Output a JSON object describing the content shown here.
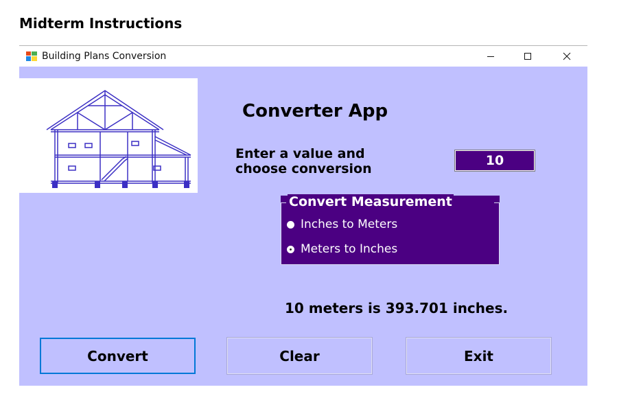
{
  "page": {
    "heading": "Midterm Instructions"
  },
  "window": {
    "title": "Building Plans Conversion",
    "icon": "app-form-icon",
    "controls": {
      "minimize_icon": "minimize-icon",
      "maximize_icon": "maximize-icon",
      "close_icon": "close-icon"
    }
  },
  "form": {
    "app_title": "Converter App",
    "prompt_line1": "Enter a value and",
    "prompt_line2": "choose conversion",
    "input_value": "10",
    "group": {
      "legend": "Convert Measurement",
      "options": [
        {
          "label": "Inches to Meters",
          "selected": false
        },
        {
          "label": "Meters to Inches",
          "selected": true
        }
      ]
    },
    "result": "10 meters is 393.701 inches.",
    "buttons": {
      "convert": "Convert",
      "clear": "Clear",
      "exit": "Exit"
    }
  },
  "colors": {
    "form_bg": "#c0c0ff",
    "accent": "#4b0082",
    "focus": "#0078d7"
  }
}
